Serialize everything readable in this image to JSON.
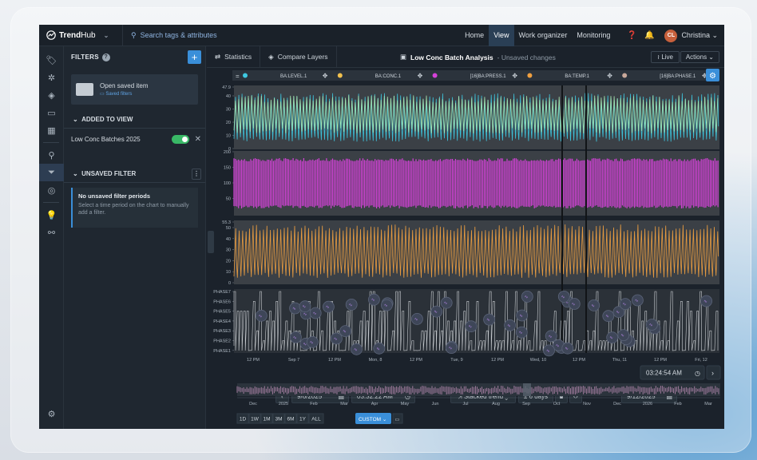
{
  "app": {
    "brand_bold": "Trend",
    "brand_rest": "Hub",
    "search_placeholder": "Search tags & attributes"
  },
  "nav": {
    "items": [
      "Home",
      "View",
      "Work organizer",
      "Monitoring"
    ],
    "active": "View",
    "user_initials": "CL",
    "user_name": "Christina"
  },
  "rail": {
    "icons": [
      "tag-icon",
      "virus-icon",
      "layers-icon",
      "chat-icon",
      "dashboard-icon",
      "search-icon",
      "filter-icon",
      "fingerprint-icon",
      "bulb-icon",
      "share-nodes-icon",
      "settings-icon"
    ]
  },
  "filters": {
    "title": "FILTERS",
    "open_saved": "Open saved item",
    "saved_filters": "Saved filters",
    "added_header": "ADDED TO VIEW",
    "added_item": "Low Conc Batches 2025",
    "unsaved_header": "UNSAVED FILTER",
    "note_title": "No unsaved filter periods",
    "note_body": "Select a time period on the chart to manually add a filter."
  },
  "toolbar": {
    "statistics": "Statistics",
    "compare": "Compare Layers",
    "view_title": "Low Conc Batch Analysis",
    "view_status": "- Unsaved changes",
    "live": "Live",
    "actions": "Actions"
  },
  "tags": [
    {
      "name": "BA:LEVEL.1",
      "color": "#3ec8e0"
    },
    {
      "name": "BA:CONC.1",
      "color": "#f2c14e"
    },
    {
      "name": "[16]BA:PRESS.1",
      "color": "#d542d9"
    },
    {
      "name": "BA:TEMP.1",
      "color": "#f0a040"
    },
    {
      "name": "[16]BA:PHASE.1",
      "color": "#c8a89a"
    }
  ],
  "axes": {
    "level": {
      "max": "47.9",
      "ticks": [
        "40",
        "30",
        "20",
        "10",
        "0"
      ]
    },
    "press": {
      "ticks": [
        "200",
        "150",
        "100",
        "50"
      ]
    },
    "temp": {
      "max": "55.3",
      "ticks": [
        "50",
        "40",
        "30",
        "20",
        "10",
        "0"
      ]
    },
    "phase": {
      "ticks": [
        "PHASE7",
        "PHASE6",
        "PHASE5",
        "PHASE4",
        "PHASE3",
        "PHASE2",
        "PHASE1"
      ]
    },
    "time": [
      "12 PM",
      "Sep 7",
      "12 PM",
      "Mon, 8",
      "12 PM",
      "Tue, 9",
      "12 PM",
      "Wed, 10",
      "12 PM",
      "Thu, 11",
      "12 PM",
      "Fri, 12"
    ]
  },
  "range": {
    "start_date": "9/6/2025",
    "start_time": "03:32:22 AM",
    "mode": "Stacked trend",
    "span": "± 6 days",
    "end_date": "9/12/2025",
    "end_time": "03:24:54 AM"
  },
  "overview": {
    "months": [
      "Dec",
      "2025",
      "Feb",
      "Mar",
      "Apr",
      "May",
      "Jun",
      "Jul",
      "Aug",
      "Sep",
      "Oct",
      "Nov",
      "Dec",
      "2026",
      "Feb",
      "Mar"
    ]
  },
  "zoom": {
    "buttons": [
      "1D",
      "1W",
      "1M",
      "3M",
      "6M",
      "1Y",
      "ALL"
    ],
    "custom": "CUSTOM"
  }
}
